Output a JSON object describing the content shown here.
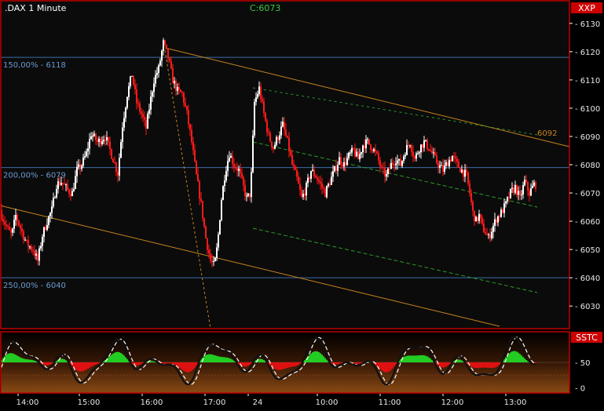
{
  "window": {
    "title": ".DAX 1 Minute",
    "close_label": "C:6073",
    "main_tag": "XXP",
    "indicator_tag": "SSTC"
  },
  "colors": {
    "background": "#000000",
    "panel_border": "#c00000",
    "up_candle": "#ffffff",
    "down_candle": "#ff1a1a",
    "fib_line": "#3a6ea8",
    "fib_text": "#6a9ad0",
    "channel": "#c8841e",
    "green_channel": "#2a9a2a",
    "tag_bg": "#cc0000"
  },
  "chart_data": [
    {
      "type": "candlestick",
      "title": ".DAX 1 Minute",
      "close_label": "C:6073",
      "ylim": [
        6022,
        6138
      ],
      "y_ticks": [
        6030,
        6040,
        6050,
        6060,
        6070,
        6080,
        6090,
        6100,
        6110,
        6120,
        6130
      ],
      "x_ticks": [
        "14:00",
        "15:00",
        "16:00",
        "17:00",
        "24",
        "10:00",
        "11:00",
        "12:00",
        "13:00"
      ],
      "fib_levels": [
        {
          "label": "150,00% - 6118",
          "value": 6118
        },
        {
          "label": "200,00% - 6079",
          "value": 6079
        },
        {
          "label": "250,00% - 6040",
          "value": 6040
        }
      ],
      "channel_label": "6092",
      "price_path": [
        [
          0,
          6064
        ],
        [
          5,
          6060
        ],
        [
          10,
          6057
        ],
        [
          15,
          6055
        ],
        [
          20,
          6062
        ],
        [
          27,
          6057
        ],
        [
          34,
          6052
        ],
        [
          42,
          6050
        ],
        [
          48,
          6046
        ],
        [
          54,
          6055
        ],
        [
          60,
          6060
        ],
        [
          66,
          6064
        ],
        [
          72,
          6073
        ],
        [
          78,
          6074
        ],
        [
          86,
          6071
        ],
        [
          92,
          6070
        ],
        [
          98,
          6078
        ],
        [
          104,
          6080
        ],
        [
          110,
          6084
        ],
        [
          116,
          6091
        ],
        [
          124,
          6088
        ],
        [
          134,
          6090
        ],
        [
          144,
          6082
        ],
        [
          150,
          6077
        ],
        [
          156,
          6094
        ],
        [
          162,
          6105
        ],
        [
          168,
          6112
        ],
        [
          174,
          6102
        ],
        [
          180,
          6098
        ],
        [
          186,
          6093
        ],
        [
          190,
          6100
        ],
        [
          196,
          6110
        ],
        [
          202,
          6114
        ],
        [
          208,
          6123
        ],
        [
          214,
          6118
        ],
        [
          220,
          6110
        ],
        [
          226,
          6106
        ],
        [
          232,
          6105
        ],
        [
          238,
          6098
        ],
        [
          244,
          6088
        ],
        [
          250,
          6076
        ],
        [
          256,
          6066
        ],
        [
          262,
          6054
        ],
        [
          268,
          6046
        ],
        [
          273,
          6044
        ],
        [
          277,
          6052
        ],
        [
          282,
          6068
        ],
        [
          287,
          6078
        ],
        [
          292,
          6084
        ],
        [
          298,
          6080
        ],
        [
          304,
          6078
        ],
        [
          309,
          6073
        ],
        [
          314,
          6068
        ],
        [
          319,
          6070
        ],
        [
          324,
          6102
        ],
        [
          330,
          6107
        ],
        [
          336,
          6098
        ],
        [
          342,
          6090
        ],
        [
          348,
          6086
        ],
        [
          354,
          6090
        ],
        [
          360,
          6094
        ],
        [
          366,
          6088
        ],
        [
          372,
          6080
        ],
        [
          378,
          6075
        ],
        [
          384,
          6068
        ],
        [
          390,
          6072
        ],
        [
          396,
          6078
        ],
        [
          402,
          6076
        ],
        [
          408,
          6073
        ],
        [
          414,
          6070
        ],
        [
          420,
          6074
        ],
        [
          426,
          6078
        ],
        [
          432,
          6082
        ],
        [
          438,
          6080
        ],
        [
          444,
          6083
        ],
        [
          450,
          6085
        ],
        [
          456,
          6082
        ],
        [
          462,
          6087
        ],
        [
          468,
          6088
        ],
        [
          474,
          6086
        ],
        [
          480,
          6083
        ],
        [
          486,
          6078
        ],
        [
          492,
          6076
        ],
        [
          498,
          6080
        ],
        [
          504,
          6082
        ],
        [
          510,
          6080
        ],
        [
          516,
          6085
        ],
        [
          522,
          6088
        ],
        [
          528,
          6082
        ],
        [
          534,
          6086
        ],
        [
          540,
          6088
        ],
        [
          546,
          6086
        ],
        [
          552,
          6083
        ],
        [
          558,
          6080
        ],
        [
          564,
          6078
        ],
        [
          570,
          6081
        ],
        [
          576,
          6083
        ],
        [
          582,
          6080
        ],
        [
          588,
          6078
        ],
        [
          594,
          6076
        ],
        [
          598,
          6070
        ],
        [
          602,
          6063
        ],
        [
          606,
          6060
        ],
        [
          610,
          6062
        ],
        [
          614,
          6058
        ],
        [
          618,
          6056
        ],
        [
          622,
          6054
        ],
        [
          626,
          6057
        ],
        [
          632,
          6061
        ],
        [
          638,
          6063
        ],
        [
          644,
          6066
        ],
        [
          650,
          6070
        ],
        [
          656,
          6072
        ],
        [
          662,
          6068
        ],
        [
          668,
          6074
        ],
        [
          674,
          6070
        ],
        [
          680,
          6073
        ]
      ]
    },
    {
      "type": "oscillator",
      "title": "SSTC",
      "ylim": [
        -10,
        110
      ],
      "y_ticks": [
        0,
        50
      ]
    }
  ]
}
